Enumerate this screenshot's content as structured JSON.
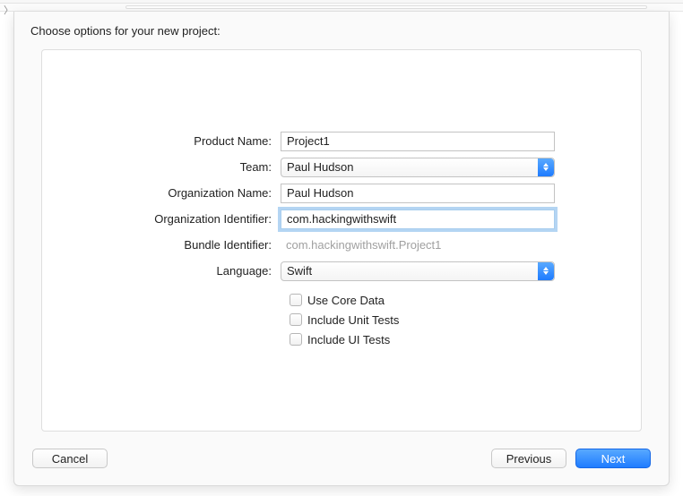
{
  "title": "Choose options for your new project:",
  "labels": {
    "product_name": "Product Name:",
    "team": "Team:",
    "organization_name": "Organization Name:",
    "organization_identifier": "Organization Identifier:",
    "bundle_identifier": "Bundle Identifier:",
    "language": "Language:"
  },
  "fields": {
    "product_name": "Project1",
    "team": "Paul Hudson",
    "organization_name": "Paul Hudson",
    "organization_identifier": "com.hackingwithswift",
    "bundle_identifier": "com.hackingwithswift.Project1",
    "language": "Swift"
  },
  "checkboxes": {
    "use_core_data": "Use Core Data",
    "include_unit_tests": "Include Unit Tests",
    "include_ui_tests": "Include UI Tests"
  },
  "buttons": {
    "cancel": "Cancel",
    "previous": "Previous",
    "next": "Next"
  }
}
